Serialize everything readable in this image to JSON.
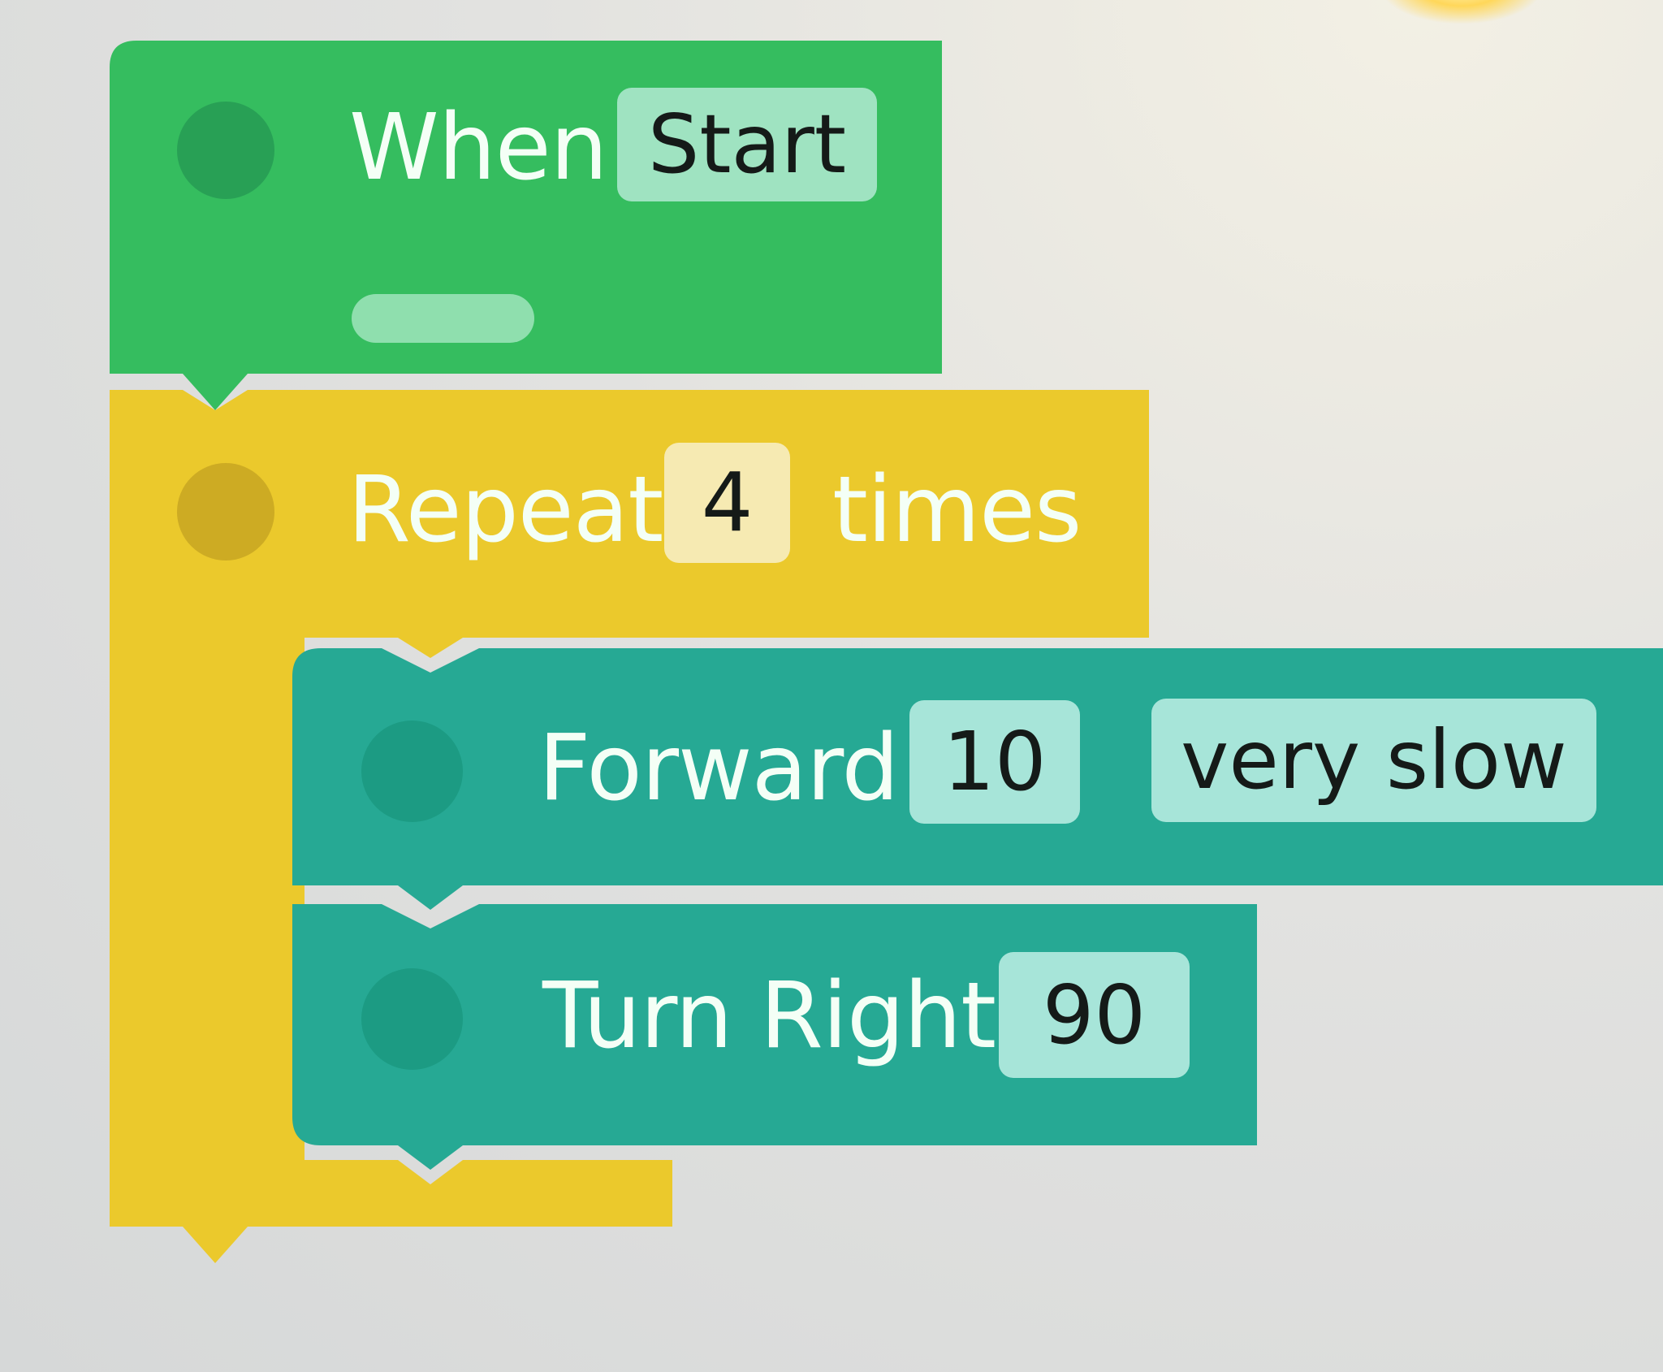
{
  "colors": {
    "event_block": "#35bd5f",
    "loop_block": "#ebc92c",
    "motion_block": "#26a994",
    "background": "#dfe0df"
  },
  "blocks": {
    "when_start": {
      "label": "When",
      "trigger": "Start"
    },
    "repeat": {
      "label_before": "Repeat",
      "count": "4",
      "label_after": "times"
    },
    "forward": {
      "label": "Forward",
      "distance": "10",
      "speed": "very slow"
    },
    "turn_right": {
      "label": "Turn Right",
      "degrees": "90"
    }
  }
}
